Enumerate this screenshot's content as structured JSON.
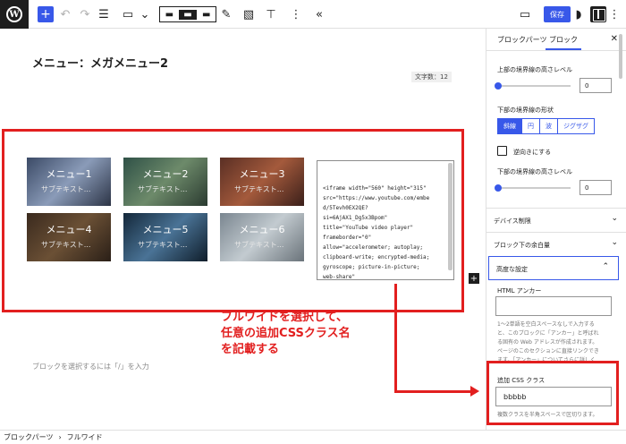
{
  "toolbar": {
    "wp_logo": "W",
    "save_label": "保存",
    "icons": [
      "plus-icon",
      "undo-icon",
      "redo-icon",
      "list-view-icon",
      "block-select-icon",
      "align-left-icon",
      "align-wide-icon",
      "align-full-icon",
      "pen-icon",
      "image-icon",
      "paint-roller-icon",
      "more-icon",
      "collapse-icon",
      "desktop-icon",
      "theme-icon",
      "sidebar-icon",
      "more-vertical-icon"
    ]
  },
  "editor": {
    "page_title": "メニュー：メガメニュー2",
    "char_count": "文字数：12",
    "menu_items": [
      {
        "title": "メニュー1",
        "subtitle": "サブテキスト..."
      },
      {
        "title": "メニュー2",
        "subtitle": "サブテキスト..."
      },
      {
        "title": "メニュー3",
        "subtitle": "サブテキスト..."
      },
      {
        "title": "メニュー4",
        "subtitle": "サブテキスト..."
      },
      {
        "title": "メニュー5",
        "subtitle": "サブテキスト..."
      },
      {
        "title": "メニュー6",
        "subtitle": "サブテキスト..."
      }
    ],
    "code_snippet": "<iframe width=\"560\" height=\"315\"\nsrc=\"https://www.youtube.com/embe\nd/5Tevh0EX2QE?\nsi=6AjAX1_Dg5x3Bpom\"\ntitle=\"YouTube video player\"\nframeborder=\"0\"\nallow=\"accelerometer; autoplay;\nclipboard-write; encrypted-media;\ngyroscope; picture-in-picture;\nweb-share\"\nreferrerpolicy=\"strict-origin-\nwhen-cross-origin\"",
    "block_placeholder": "ブロックを選択するには「/」を入力",
    "annotation": "フルワイドを選択して、\n任意の追加CSSクラス名\nを記載する"
  },
  "sidebar": {
    "tabs": [
      "ブロックパーツ",
      "ブロック"
    ],
    "upper_border_height_label": "上部の境界線の高さレベル",
    "upper_border_height_value": "0",
    "lower_border_shape_label": "下部の境界線の形状",
    "lower_border_shapes": [
      "斜線",
      "円",
      "波",
      "ジグザグ"
    ],
    "lower_border_shape_selected": "斜線",
    "reverse_label": "逆向きにする",
    "lower_border_height_label": "下部の境界線の高さレベル",
    "lower_border_height_value": "0",
    "panels": [
      "デバイス制限",
      "ブロック下の余白量",
      "高度な設定"
    ],
    "html_anchor_label": "HTML アンカー",
    "html_anchor_value": "",
    "html_anchor_help": "1〜2単語を空白スペースなしで入力する\nと、このブロックに「アンカー」と呼ばれ\nる固有の Web アドレスが作成されます。\nページのこのセクションに直接リンクでき\nます。「アンカー」についてさらに詳しく",
    "css_class_label": "追加 CSS クラス",
    "css_class_value": "bbbbb",
    "css_class_help": "複数クラスを半角スペースで区切ります。"
  },
  "breadcrumb": [
    "ブロックパーツ",
    "フルワイド"
  ],
  "colors": {
    "accent": "#3858e9",
    "annotation_red": "#e21f1f",
    "dark": "#1e1e1e"
  }
}
